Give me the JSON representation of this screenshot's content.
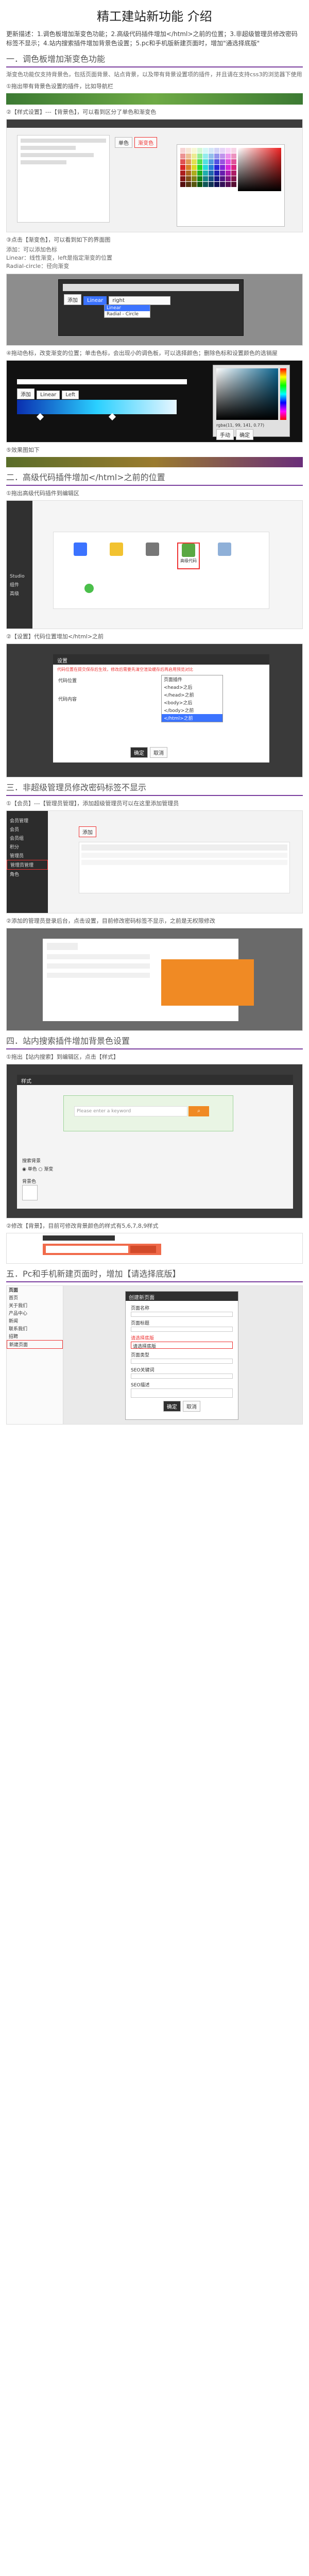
{
  "page": {
    "title": "精工建站新功能 介绍",
    "intro": "更新描述：1.调色板增加渐变色功能；2.高级代码插件增加</html>之前的位置；3.非超级管理员修改密码标签不显示；4.站内搜索插件增加背景色设置；5.pc和手机版新建页面时，增加\"通选择底版\""
  },
  "sections": [
    {
      "heading": "一．调色板增加渐变色功能",
      "desc1": "渐变色功能仅支持背景色，包括页面背景、站点背景，以及带有背景设置项的插件，并且请在支持css3的浏览器下使用",
      "steps": [
        "①拖出带有背景色设置的插件，比如导航栏",
        "②【样式设置】---【背景色】，可以看到区分了单色和渐变色",
        "③点击【渐变色】，可以看到如下的界面图",
        "④拖动色标，改变渐变的位置；单击色标，会出现小的调色板，可以选择颜色；删除色标和设置颜色的选销屋",
        "⑤效果图如下"
      ],
      "notes": [
        "添加：可以添加色标",
        "Linear：线性渐变，left是指定渐变的位置",
        "Radial-circle：径向渐变"
      ],
      "ui": {
        "tab_single": "单色",
        "tab_gradient": "渐变色",
        "add_button": "添加",
        "mode_value": "Linear",
        "dir_value": "right",
        "dir_value2": "Left",
        "mode_options": [
          "Linear",
          "Radial - Circle"
        ],
        "color_readout": "rgba(11, 99, 141, 0.77)",
        "picker_mode": "手动",
        "picker_ok": "确定"
      }
    },
    {
      "heading": "二．高级代码插件增加</html>之前的位置",
      "steps": [
        "①拖出高级代码插件到编辑区",
        "②【设置】代码位置增加</html>之前"
      ],
      "ui": {
        "left_menu": [
          "Studio",
          "组件",
          "高级"
        ],
        "dialog_title": "设置",
        "dialog_note": "代码位置在提交保存后生效，修改后需要先清空渲染缓存后再启用预览对比",
        "select_label": "代码位置",
        "code_label": "代码内容",
        "options": [
          "页面插件",
          "<head>之后",
          "</head>之前",
          "<body>之后",
          "</body>之前",
          "</html>之前"
        ],
        "ok": "确定",
        "cancel": "取消",
        "tiles": [
          "",
          "",
          "",
          "高级代码",
          ""
        ]
      }
    },
    {
      "heading": "三．非超级管理员修改密码标签不显示",
      "steps": [
        "①【会员】---【管理员管理】，添加超级管理员可以在这里添加管理员",
        "②添加的管理员登录后台，点击设置，目前修改密码标签不显示，之前是无权限修改"
      ],
      "ui": {
        "sidebar": [
          "会员管理",
          "会员",
          "会员组",
          "积分",
          "管理员",
          "管理员管理",
          "角色"
        ],
        "add_button": "添加"
      }
    },
    {
      "heading": "四．站内搜索插件增加背景色设置",
      "steps": [
        "①拖出【站内搜索】到编辑区，点击【样式】",
        "②修改【背景】，目前可修改背景颜色的样式有5,6,7,8,9样式"
      ],
      "ui": {
        "dialog_title": "样式",
        "search_placeholder": "Please enter a keyword",
        "label_bg": "搜索背景",
        "opt1": "单色",
        "opt2": "渐变",
        "label_color": "背景色"
      }
    },
    {
      "heading": "五．Pc和手机新建页面时，增加【请选择底版】",
      "ui": {
        "sidebar_title": "页面",
        "sidebar": [
          "首页",
          "关于我们",
          "产品中心",
          "新闻",
          "联系我们",
          "招聘",
          "新建页面"
        ],
        "dialog_title": "创建新页面",
        "field_labels": [
          "页面名称",
          "页面标题",
          "请选择底版",
          "页面类型",
          "SEO关键词",
          "SEO描述"
        ],
        "template_value": "请选择底版",
        "ok": "确定",
        "cancel": "取消"
      }
    }
  ],
  "colors": {
    "accent_purple": "#7a3e9e",
    "heading_text": "#555555",
    "green_bar": "#3c7a33",
    "orange": "#f08a24",
    "blue_select": "#3b73ff"
  }
}
